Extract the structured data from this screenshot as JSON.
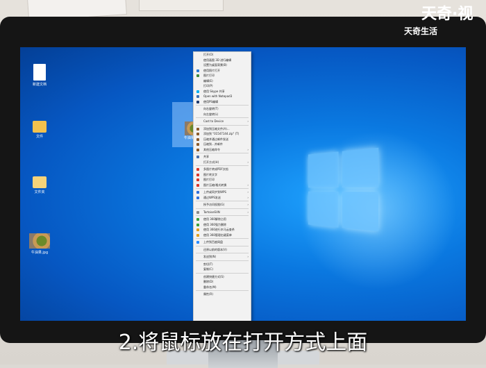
{
  "brand": {
    "line1": "天奇·视",
    "line2": "天奇生活"
  },
  "subtitle": "2.将鼠标放在打开方式上面",
  "desktop_icons": [
    {
      "label": "新建文档"
    },
    {
      "label": "文件"
    },
    {
      "label": "文件夹"
    },
    {
      "label": "牛油果.jpg"
    }
  ],
  "selected_file": {
    "label": "牛油果.jpg"
  },
  "context_menu": {
    "items": [
      {
        "label": "打开(O)",
        "icon": "none",
        "arrow": ""
      },
      {
        "label": "使用画图 3D 进行编辑",
        "icon": "none",
        "arrow": ""
      },
      {
        "label": "设置为桌面背景(B)",
        "icon": "none",
        "arrow": ""
      },
      {
        "label": "使用照片打开",
        "icon": "photo",
        "arrow": ""
      },
      {
        "label": "图片打印",
        "icon": "print",
        "arrow": ""
      },
      {
        "label": "编辑(E)",
        "icon": "none",
        "arrow": ""
      },
      {
        "label": "打印(P)",
        "icon": "none",
        "arrow": ""
      },
      {
        "label": "使用 Skype 共享",
        "icon": "skype",
        "arrow": ""
      },
      {
        "label": "Open with Notepad3",
        "icon": "notepad",
        "arrow": ""
      },
      {
        "label": "使用PS编辑",
        "icon": "ps",
        "arrow": ""
      },
      {
        "sep": true
      },
      {
        "label": "向右旋转(T)",
        "icon": "none",
        "arrow": ""
      },
      {
        "label": "向左旋转(L)",
        "icon": "none",
        "arrow": ""
      },
      {
        "sep": true
      },
      {
        "label": "Cast to Device",
        "icon": "none",
        "arrow": "›"
      },
      {
        "sep": true
      },
      {
        "label": "添加到压缩文件(A)...",
        "icon": "zip",
        "arrow": ""
      },
      {
        "label": "添加到 \"01547144.zip\" (T)",
        "icon": "zip",
        "arrow": ""
      },
      {
        "label": "压缩并通过邮件发送",
        "icon": "zip",
        "arrow": ""
      },
      {
        "label": "压缩到...并邮件",
        "icon": "zip",
        "arrow": ""
      },
      {
        "label": "其他压缩命令",
        "icon": "zip",
        "arrow": "›"
      },
      {
        "sep": true
      },
      {
        "label": "共享",
        "icon": "share",
        "arrow": ""
      },
      {
        "label": "打开方式(H)",
        "icon": "none",
        "arrow": "›"
      },
      {
        "sep": true
      },
      {
        "label": "多图片转成PDF文档",
        "icon": "pdf",
        "arrow": ""
      },
      {
        "label": "图片转文字",
        "icon": "pdf",
        "arrow": ""
      },
      {
        "label": "图片打印",
        "icon": "pdf",
        "arrow": ""
      },
      {
        "label": "图片压缩/格式转换",
        "icon": "pdf",
        "arrow": "›"
      },
      {
        "sep": true
      },
      {
        "label": "上传或同步到WPS",
        "icon": "wps",
        "arrow": "›"
      },
      {
        "label": "通过WPS发送",
        "icon": "wps",
        "arrow": "›"
      },
      {
        "sep": true
      },
      {
        "label": "授予访问权限(G)",
        "icon": "none",
        "arrow": "›"
      },
      {
        "sep": true
      },
      {
        "label": "TortoiseSVN",
        "icon": "svn",
        "arrow": "›"
      },
      {
        "sep": true
      },
      {
        "label": "使用 360解除占用",
        "icon": "s360",
        "arrow": ""
      },
      {
        "label": "使用 360强力删除",
        "icon": "s360",
        "arrow": ""
      },
      {
        "label": "使用 360进行木马云查杀",
        "icon": "s360g",
        "arrow": ""
      },
      {
        "label": "使用 360管理右键菜单",
        "icon": "s360g",
        "arrow": ""
      },
      {
        "sep": true
      },
      {
        "label": "上传到百度网盘",
        "icon": "baidu",
        "arrow": ""
      },
      {
        "sep": true
      },
      {
        "label": "还原以前的版本(V)",
        "icon": "none",
        "arrow": ""
      },
      {
        "sep": true
      },
      {
        "label": "发送到(N)",
        "icon": "none",
        "arrow": "›"
      },
      {
        "sep": true
      },
      {
        "label": "剪切(T)",
        "icon": "none",
        "arrow": ""
      },
      {
        "label": "复制(C)",
        "icon": "none",
        "arrow": ""
      },
      {
        "sep": true
      },
      {
        "label": "创建快捷方式(S)",
        "icon": "none",
        "arrow": ""
      },
      {
        "label": "删除(D)",
        "icon": "none",
        "arrow": ""
      },
      {
        "label": "重命名(M)",
        "icon": "none",
        "arrow": ""
      },
      {
        "sep": true
      },
      {
        "label": "属性(R)",
        "icon": "none",
        "arrow": ""
      }
    ]
  },
  "icon_colors": {
    "none": "transparent",
    "photo": "#2b7cd3",
    "print": "#3c8a3c",
    "skype": "#00aff0",
    "notepad": "#3a6fb0",
    "ps": "#1f3a6e",
    "zip": "#8b5a2b",
    "share": "#4a6da7",
    "pdf": "#d9342b",
    "wps": "#2f6fdb",
    "svn": "#8a8a8a",
    "s360": "#3aa03a",
    "s360g": "#e0a020",
    "baidu": "#2a8cff"
  }
}
